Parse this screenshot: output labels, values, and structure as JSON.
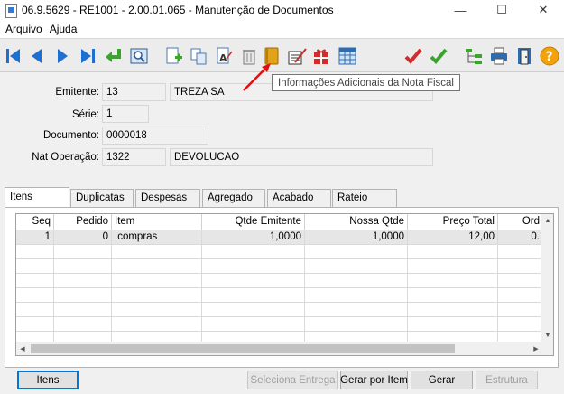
{
  "window": {
    "title": "06.9.5629 - RE1001 - 2.00.01.065 - Manutenção de Documentos",
    "minimize": "—",
    "maximize": "☐",
    "close": "✕"
  },
  "menu": {
    "items": [
      "Arquivo",
      "Ajuda"
    ]
  },
  "toolbar": {
    "buttons": [
      "first-record-icon",
      "previous-record-icon",
      "next-record-icon",
      "last-record-icon",
      "goto-return-icon",
      "search-record-icon",
      "new-document-icon",
      "copy-icon",
      "edit-text-icon",
      "delete-trash-icon",
      "additional-info-book-icon",
      "edit-fill-icon",
      "gift-package-icon",
      "calendar-grid-icon",
      "cancel-check-icon",
      "confirm-check-icon",
      "structure-tree-icon",
      "print-icon",
      "exit-door-icon",
      "help-icon"
    ],
    "tooltip": "Informações Adicionais da Nota Fiscal"
  },
  "form": {
    "emitente_label": "Emitente:",
    "emitente_code": "13",
    "emitente_name": "TREZA SA",
    "serie_label": "Série:",
    "serie_value": "1",
    "documento_label": "Documento:",
    "documento_value": "0000018",
    "nat_operacao_label": "Nat Operação:",
    "nat_operacao_code": "1322",
    "nat_operacao_desc": "DEVOLUCAO"
  },
  "tabs": [
    "Itens",
    "Duplicatas",
    "Despesas",
    "Agregado",
    "Acabado",
    "Rateio"
  ],
  "grid": {
    "columns": [
      "Seq",
      "Pedido",
      "Item",
      "Qtde Emitente",
      "Nossa Qtde",
      "Preço Total",
      "Ord"
    ],
    "rows": [
      {
        "seq": "1",
        "pedido": "0",
        "item": ".compras",
        "qtde_emitente": "1,0000",
        "nossa_qtde": "1,0000",
        "preco_total": "12,00",
        "ord": "0."
      }
    ]
  },
  "buttons": {
    "itens": "Itens",
    "seleciona_entrega": "Seleciona Entrega",
    "gerar_por_item": "Gerar por Item",
    "gerar": "Gerar",
    "estrutura": "Estrutura"
  }
}
